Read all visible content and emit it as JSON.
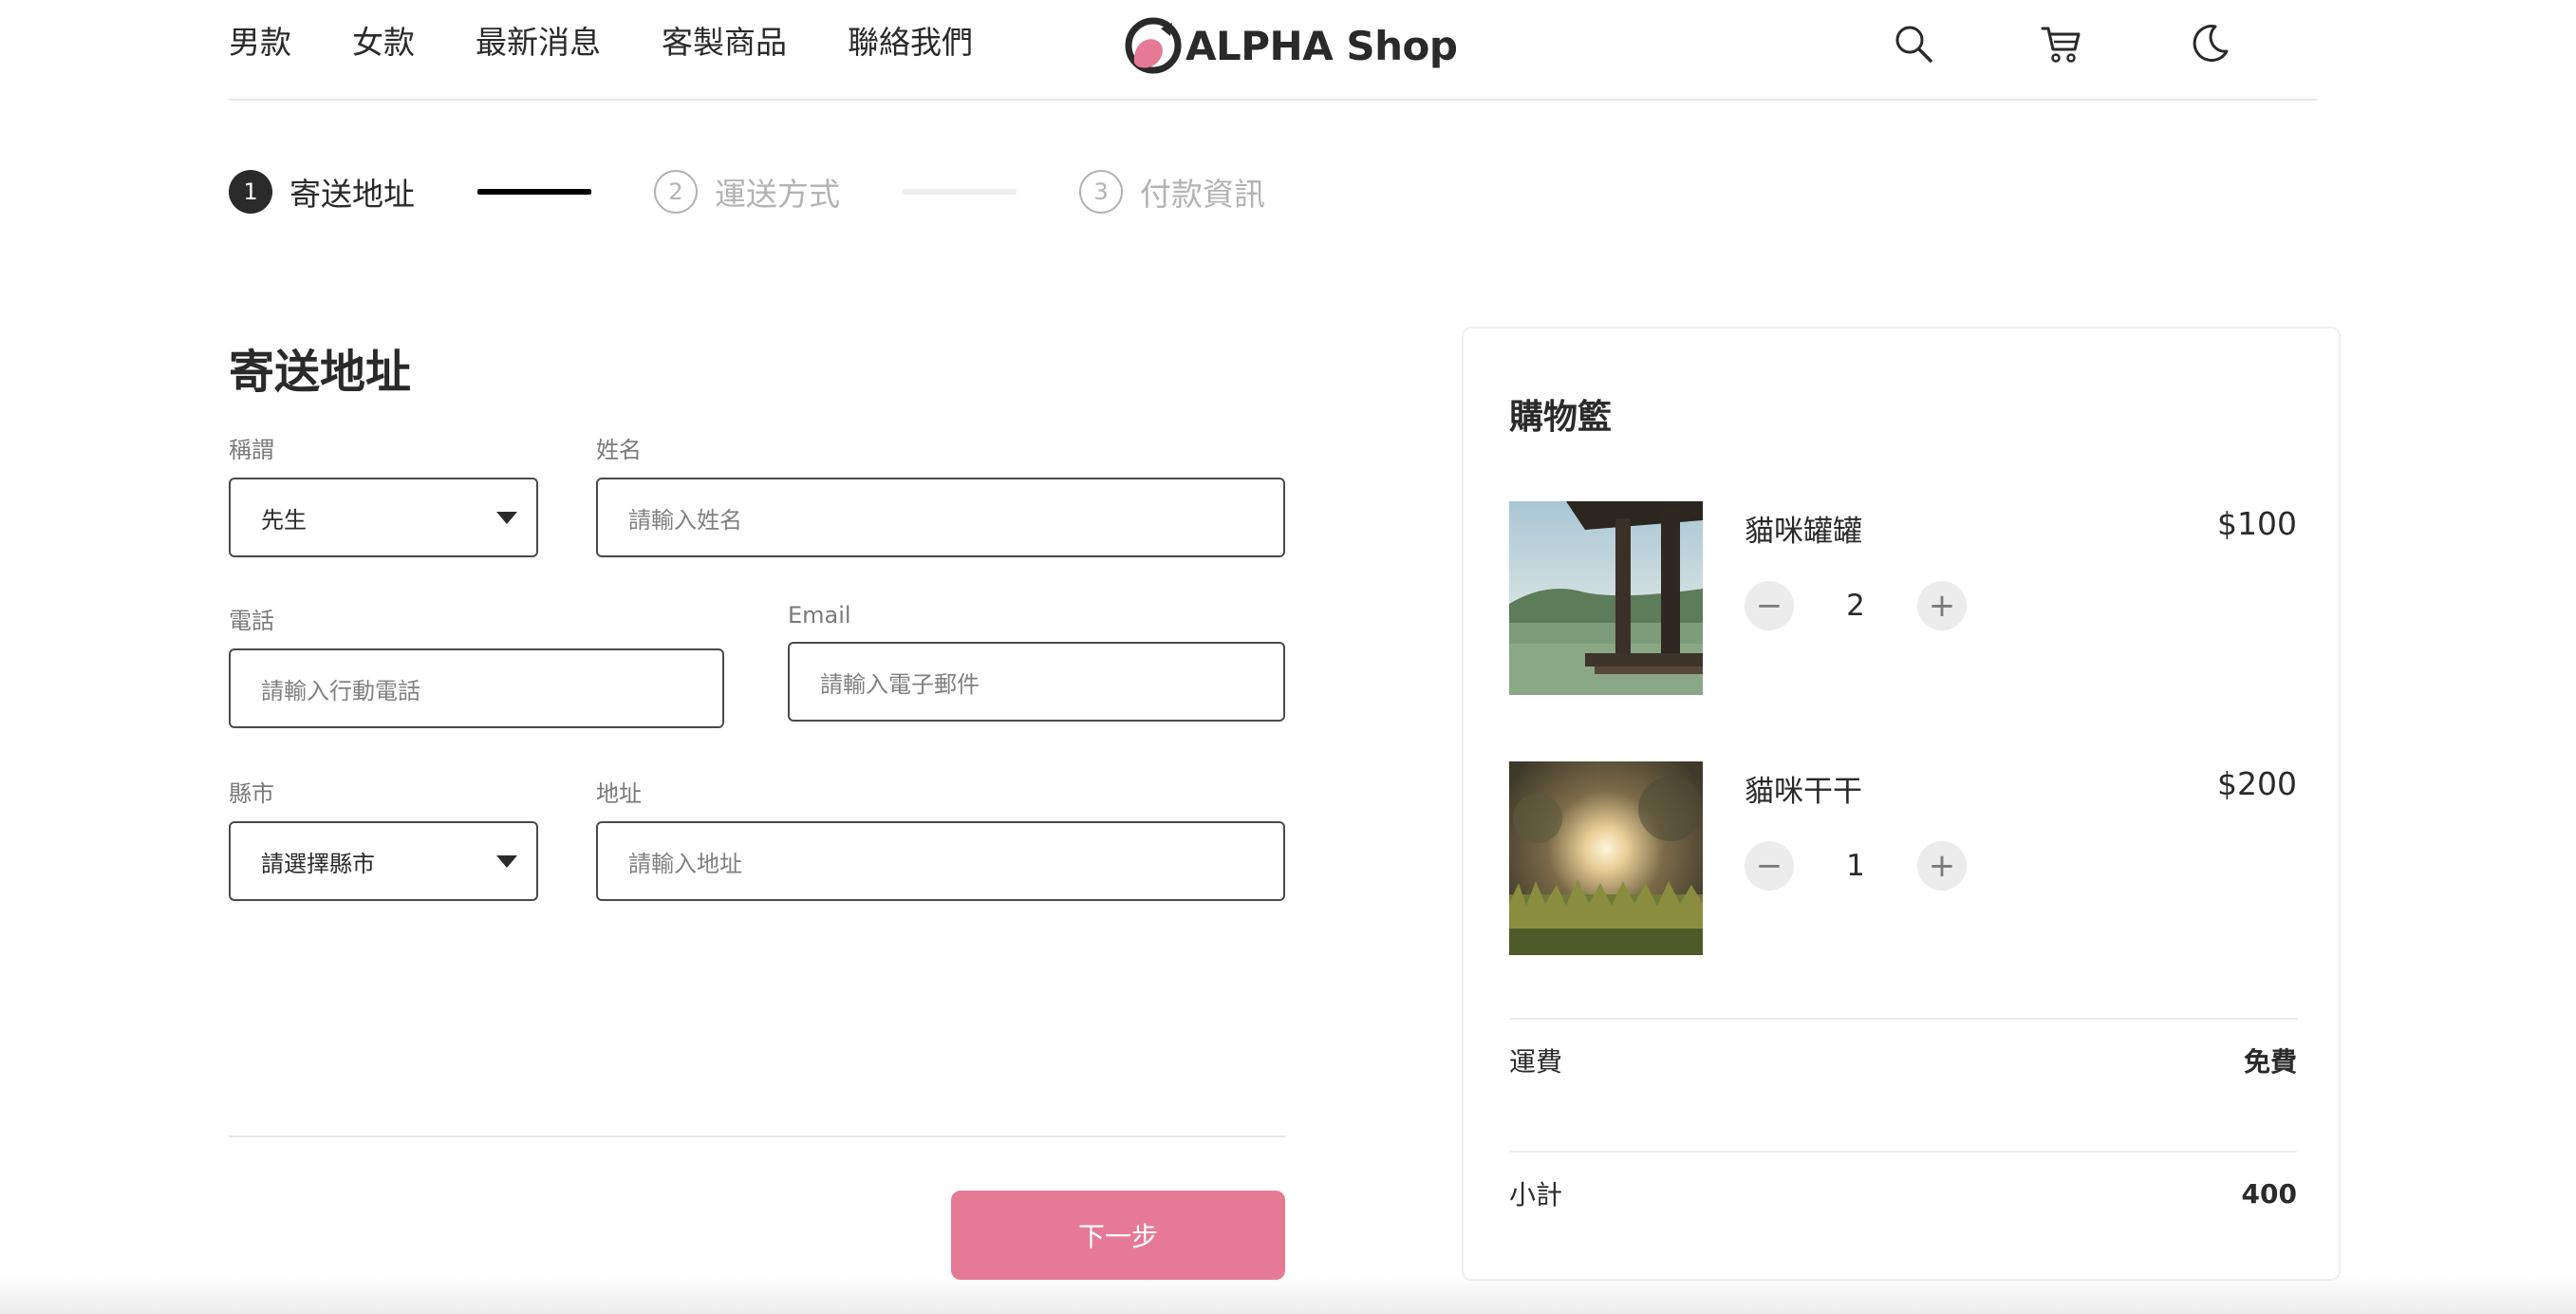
{
  "header": {
    "nav": [
      "男款",
      "女款",
      "最新消息",
      "客製商品",
      "聯絡我們"
    ],
    "logo_text": "ALPHA Shop",
    "logo_color": "#e67a96",
    "icons": [
      "search-icon",
      "cart-icon",
      "moon-icon"
    ]
  },
  "stepper": {
    "steps": [
      {
        "number": "1",
        "label": "寄送地址",
        "state": "active"
      },
      {
        "number": "2",
        "label": "運送方式",
        "state": "pending"
      },
      {
        "number": "3",
        "label": "付款資訊",
        "state": "pending"
      }
    ]
  },
  "form": {
    "title": "寄送地址",
    "salutation": {
      "label": "稱謂",
      "value": "先生"
    },
    "name": {
      "label": "姓名",
      "placeholder": "請輸入姓名"
    },
    "phone": {
      "label": "電話",
      "placeholder": "請輸入行動電話"
    },
    "email": {
      "label": "Email",
      "placeholder": "請輸入電子郵件"
    },
    "city": {
      "label": "縣市",
      "value": "請選擇縣市"
    },
    "address": {
      "label": "地址",
      "placeholder": "請輸入地址"
    },
    "next_label": "下一步",
    "accent_color": "#e67a96"
  },
  "cart": {
    "title": "購物籃",
    "items": [
      {
        "name": "貓咪罐罐",
        "price": "$100",
        "quantity": "2",
        "image": "lake-pier-photo"
      },
      {
        "name": "貓咪干干",
        "price": "$200",
        "quantity": "1",
        "image": "sunset-grass-photo"
      }
    ],
    "minus": "−",
    "plus": "+",
    "shipping_label": "運費",
    "shipping_value": "免費",
    "subtotal_label": "小計",
    "subtotal_value": "400"
  }
}
